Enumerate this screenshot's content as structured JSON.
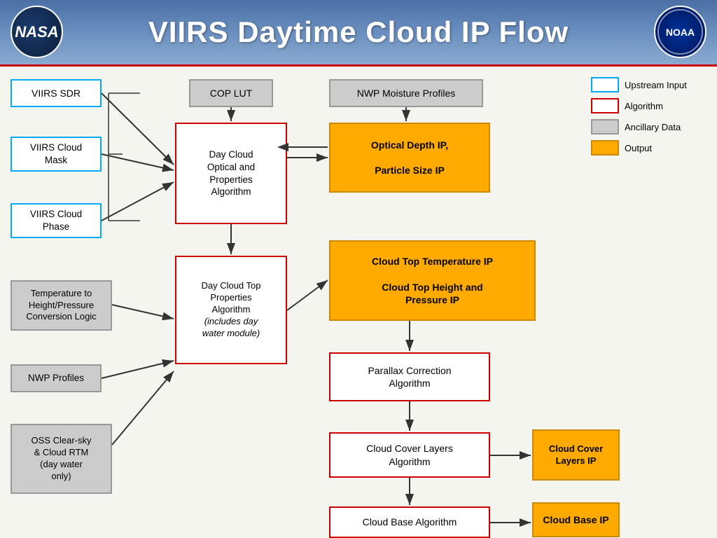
{
  "header": {
    "title": "VIIRS Daytime Cloud IP Flow",
    "nasa_label": "NASA",
    "noaa_label": "NOAA"
  },
  "legend": {
    "items": [
      {
        "type": "upstream",
        "label": "Upstream Input"
      },
      {
        "type": "algorithm",
        "label": "Algorithm"
      },
      {
        "type": "ancillary",
        "label": "Ancillary Data"
      },
      {
        "type": "output",
        "label": "Output"
      }
    ]
  },
  "boxes": {
    "viirs_sdr": "VIIRS SDR",
    "viirs_cloud_mask": "VIIRS Cloud\nMask",
    "viirs_cloud_phase": "VIIRS Cloud\nPhase",
    "temp_height": "Temperature to\nHeight/Pressure\nConversion Logic",
    "nwp_profiles": "NWP Profiles",
    "oss_clear": "OSS Clear-sky\n& Cloud RTM\n(day water\nonly)",
    "cop_lut": "COP LUT",
    "nwp_moisture": "NWP Moisture Profiles",
    "day_cloud_optical": "Day Cloud\nOptical and\nProperties\nAlgorithm",
    "optical_depth_ip": "Optical Depth IP,\n\nParticle Size IP",
    "day_cloud_top": "Day Cloud Top\nProperties\nAlgorithm\n(includes day\nwater module)",
    "cloud_top_temp": "Cloud Top Temperature IP\n\nCloud Top Height and\nPressure IP",
    "parallax": "Parallax Correction\nAlgorithm",
    "cloud_cover_layers_alg": "Cloud Cover Layers\nAlgorithm",
    "cloud_cover_layers_ip": "Cloud Cover\nLayers IP",
    "cloud_base_alg": "Cloud Base Algorithm",
    "cloud_base_ip": "Cloud Base IP"
  }
}
